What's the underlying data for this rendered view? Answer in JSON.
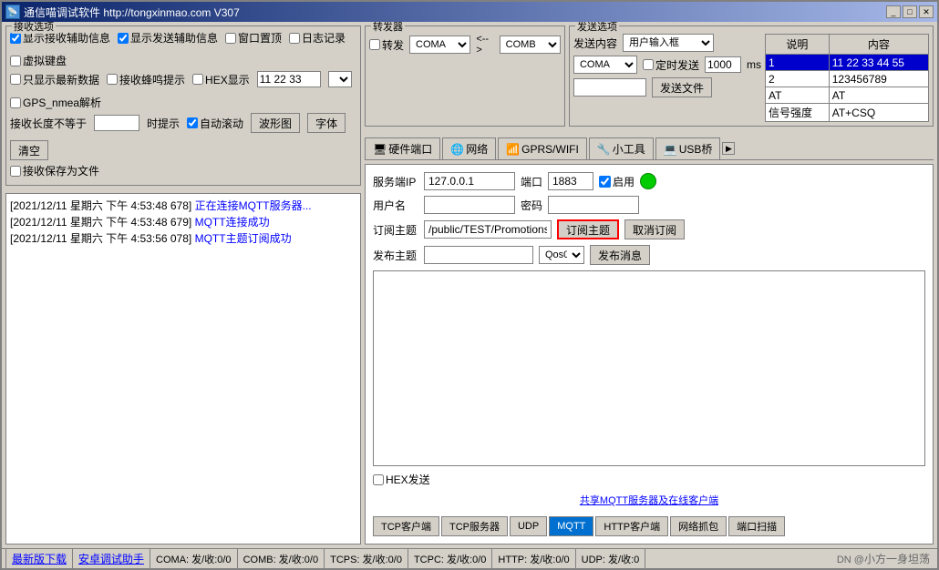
{
  "window": {
    "title": "通信喵调试软件  http://tongxinmao.com  V307",
    "icon": "🐱"
  },
  "titlebar": {
    "minimize_label": "_",
    "maximize_label": "□",
    "close_label": "✕"
  },
  "receive_options": {
    "title": "接收选项",
    "options": [
      {
        "id": "show_recv_aux",
        "label": "显示接收辅助信息",
        "checked": true
      },
      {
        "id": "show_send_aux",
        "label": "显示发送辅助信息",
        "checked": true
      },
      {
        "id": "window_top",
        "label": "窗口置顶",
        "checked": false
      },
      {
        "id": "log",
        "label": "日志记录",
        "checked": false
      },
      {
        "id": "virtual_kb",
        "label": "虚拟键盘",
        "checked": false
      },
      {
        "id": "only_latest",
        "label": "只显示最新数据",
        "checked": false
      },
      {
        "id": "recv_beep",
        "label": "接收蜂鸣提示",
        "checked": false
      },
      {
        "id": "hex_display",
        "label": "HEX显示",
        "checked": false
      },
      {
        "id": "gps_nmea",
        "label": "GPS_nmea解析",
        "checked": false
      }
    ],
    "hex_input": "11 22 33",
    "recv_length_label": "接收长度不等于",
    "recv_length_value": "",
    "time_prompt_label": "时提示",
    "auto_scroll_label": "自动滚动",
    "auto_scroll_checked": true,
    "wave_btn": "波形图",
    "font_btn": "字体",
    "clear_btn": "清空",
    "save_label": "接收保存为文件"
  },
  "log_entries": [
    {
      "time": "[2021/12/11 星期六 下午 4:53:48 678]",
      "text": "正在连接MQTT服务器..."
    },
    {
      "time": "[2021/12/11 星期六 下午 4:53:48 679]",
      "text": "MQTT连接成功"
    },
    {
      "time": "[2021/12/11 星期六 下午 4:53:56 078]",
      "text": "MQTT主题订阅成功"
    }
  ],
  "forwarder": {
    "title": "转发器",
    "forward_label": "转发",
    "port_a": "COMA",
    "arrow": "<-->",
    "port_b": "COMB"
  },
  "send_options": {
    "title": "发送选项",
    "send_content_label": "发送内容",
    "send_content_value": "用户输入框",
    "port_label": "COMA",
    "timed_send_label": "定时发送",
    "timed_ms": "1000",
    "ms_label": "ms",
    "send_file_btn": "发送文件",
    "table_headers": [
      "说明",
      "内容"
    ],
    "table_rows": [
      {
        "selected": true,
        "id": "1",
        "content": "11 22 33 44 55"
      },
      {
        "selected": false,
        "id": "2",
        "content": "123456789"
      },
      {
        "selected": false,
        "id": "AT",
        "content": "AT"
      },
      {
        "selected": false,
        "id": "信号强度",
        "content": "AT+CSQ"
      }
    ]
  },
  "tabs": [
    {
      "icon": "🖥",
      "label": "硬件端口",
      "active": false
    },
    {
      "icon": "🌐",
      "label": "网络",
      "active": false
    },
    {
      "icon": "📶",
      "label": "GPRS/WIFI",
      "active": false
    },
    {
      "icon": "🔧",
      "label": "小工具",
      "active": false
    },
    {
      "icon": "💻",
      "label": "USB桥",
      "active": false
    },
    {
      "icon": "◀",
      "label": "",
      "nav": true
    }
  ],
  "mqtt": {
    "server_ip_label": "服务端IP",
    "server_ip": "127.0.0.1",
    "port_label": "端口",
    "port": "1883",
    "enable_label": "启用",
    "enable_checked": true,
    "username_label": "用户名",
    "password_label": "密码",
    "subscribe_topic_label": "订阅主题",
    "subscribe_topic": "/public/TEST/Promotions",
    "subscribe_btn": "订阅主题",
    "unsubscribe_btn": "取消订阅",
    "publish_topic_label": "发布主题",
    "qos_label": "Qos0",
    "publish_btn": "发布消息",
    "hex_send_label": "HEX发送",
    "hex_send_checked": false,
    "share_link": "共享MQTT服务器及在线客户端"
  },
  "bottom_tabs": [
    {
      "label": "TCP客户端",
      "active": false
    },
    {
      "label": "TCP服务器",
      "active": false
    },
    {
      "label": "UDP",
      "active": false
    },
    {
      "label": "MQTT",
      "active": true
    },
    {
      "label": "HTTP客户端",
      "active": false
    },
    {
      "label": "网络抓包",
      "active": false
    },
    {
      "label": "端口扫描",
      "active": false
    }
  ],
  "status_bar": {
    "update_link": "最新版下载",
    "android_link": "安卓调试助手",
    "coma_status": "COMA: 发/收:0/0",
    "comb_status": "COMB: 发/收:0/0",
    "tcps_status": "TCPS: 发/收:0/0",
    "tcpc_status": "TCPC: 发/收:0/0",
    "http_status": "HTTP: 发/收:0/0",
    "udp_status": "UDP: 发/收:0",
    "watermark": "小方一身坦荡"
  }
}
